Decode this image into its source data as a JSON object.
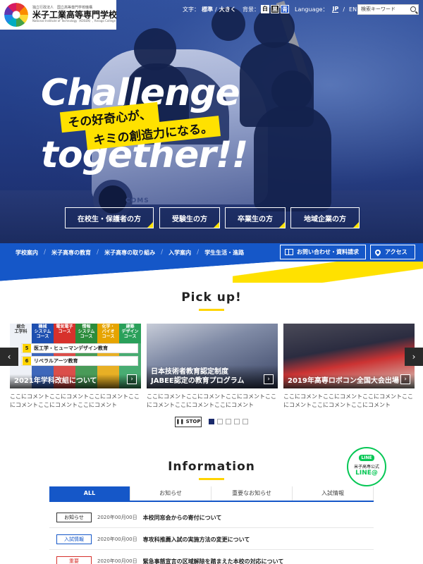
{
  "header": {
    "logo_small": "独立行政法人　国立高等専門学校機構",
    "logo_name": "米子工業高等専門学校",
    "logo_en": "National Institute of Technology（KOSEN）, Yonago College",
    "text_size_label": "文字：",
    "text_size_standard": "標準",
    "text_size_sep": "/",
    "text_size_large": "大きく",
    "bg_label": "背景：",
    "bg_white": "白",
    "bg_black": "黒",
    "bg_blue": "青",
    "language_label": "Language：",
    "lang_jp": "JP",
    "lang_sep": "/",
    "lang_en": "EN",
    "search_placeholder": "検索キーワード"
  },
  "hero": {
    "title_line1": "Challenge",
    "title_line2": "together!!",
    "tag_line1": "その好奇心が、",
    "tag_line2": "キミの創造力になる。",
    "car_brand": "COMS",
    "audience_buttons": [
      "在校生・保護者の方",
      "受験生の方",
      "卒業生の方",
      "地域企業の方"
    ]
  },
  "nav": {
    "items": [
      "学校案内",
      "米子高専の教育",
      "米子高専の取り組み",
      "入学案内",
      "学生生活・進路"
    ],
    "separator": "/",
    "contact": "お問い合わせ・資料請求",
    "access": "アクセス"
  },
  "pickup": {
    "title": "Pick up!",
    "prev": "‹",
    "next": "›",
    "arrow": "›",
    "cards": [
      {
        "caption": "2021年学科改組について",
        "desc": "ここにコメントここにコメントここにコメントここにコメントここにコメントここにコメント",
        "columns": [
          "総合\n工学科",
          "機械\nシステム\nコース",
          "電気電子\nコース",
          "情報\nシステム\nコース",
          "化学・\nバイオ\nコース",
          "建築\nデザイン\nコース"
        ],
        "program1_num": "5",
        "program1": "医工学・ヒューマンデザイン教育",
        "program2_num": "6",
        "program2": "リベラルアーツ教育"
      },
      {
        "caption": "日本技術者教育認定制度\nJABEE認定の教育プログラム",
        "desc": "ここにコメントここにコメントここにコメントここにコメントここにコメントここにコメント"
      },
      {
        "caption": "2019年高専ロボコン全国大会出場",
        "desc": "ここにコメントここにコメントここにコメントここにコメントここにコメントここにコメント"
      }
    ],
    "stop_label": "❚❚ STOP",
    "dot_count": 5,
    "active_dot": 0
  },
  "information": {
    "title": "Information",
    "line_logo": "LINE",
    "line_text": "米子高専公式",
    "line_label": "LINE@",
    "tabs": [
      "ALL",
      "お知らせ",
      "重要なお知らせ",
      "入試情報"
    ],
    "active_tab": 0,
    "news": [
      {
        "category": "お知らせ",
        "date": "2020年00月00日",
        "title": "本校同窓会からの寄付について",
        "style": "default"
      },
      {
        "category": "入試情報",
        "date": "2020年00月00日",
        "title": "専攻科推薦入試の実施方法の変更について",
        "style": "blue"
      },
      {
        "category": "重要",
        "date": "2020年00月00日",
        "title": "緊急事態宣言の区域解除を踏まえた本校の対応について",
        "style": "red"
      }
    ]
  },
  "colors": {
    "primary_blue": "#1557c8",
    "accent_yellow": "#ffe100",
    "line_green": "#06c755"
  }
}
